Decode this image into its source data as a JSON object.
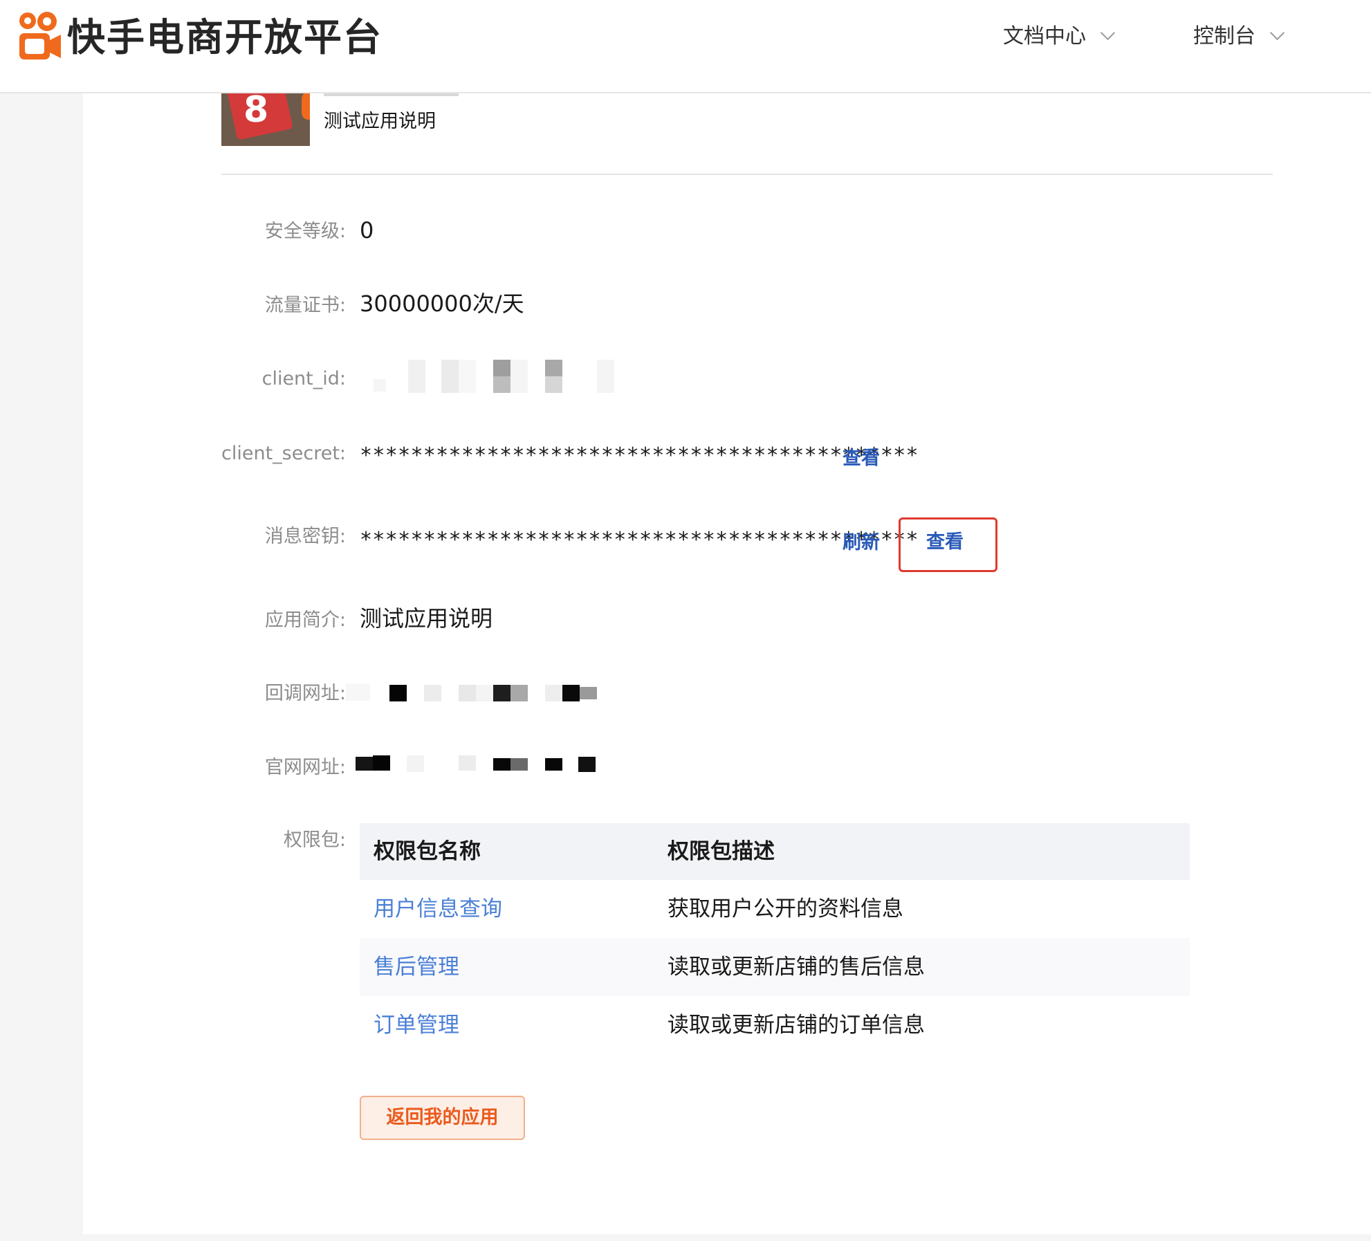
{
  "header": {
    "brand": "快手电商开放平台",
    "nav": {
      "docs_label": "文档中心",
      "console_label": "控制台"
    }
  },
  "app": {
    "description_short": "测试应用说明"
  },
  "fields": {
    "security_level": {
      "label": "安全等级:",
      "value": "0"
    },
    "traffic_cert": {
      "label": "流量证书:",
      "value": "30000000次/天"
    },
    "client_id": {
      "label": "client_id:"
    },
    "client_secret": {
      "label": "client_secret:",
      "value": "********************************************",
      "view_label": "查看"
    },
    "message_key": {
      "label": "消息密钥:",
      "value": "********************************************",
      "refresh_label": "刷新",
      "view_label": "查看"
    },
    "app_intro": {
      "label": "应用简介:",
      "value": "测试应用说明"
    },
    "callback_url": {
      "label": "回调网址:"
    },
    "website_url": {
      "label": "官网网址:"
    },
    "permissions_label": "权限包:"
  },
  "permissions": {
    "headers": [
      "权限包名称",
      "权限包描述"
    ],
    "rows": [
      {
        "name": "用户信息查询",
        "desc": "获取用户公开的资料信息"
      },
      {
        "name": "售后管理",
        "desc": "读取或更新店铺的售后信息"
      },
      {
        "name": "订单管理",
        "desc": "读取或更新店铺的订单信息"
      }
    ]
  },
  "actions": {
    "back_label": "返回我的应用"
  },
  "colors": {
    "brand_orange": "#ea5a1c",
    "link_blue": "#2a5ab8",
    "highlight_red": "#e03a2f"
  }
}
